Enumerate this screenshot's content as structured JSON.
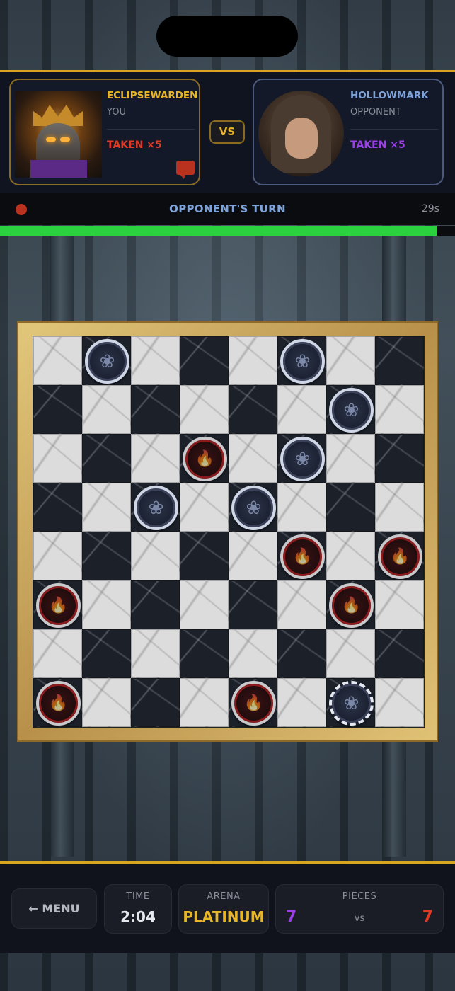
{
  "players": {
    "you": {
      "name": "ECLIPSEWARDEN",
      "role": "YOU",
      "taken": "TAKEN ×5",
      "name_color": "#e9b528",
      "taken_color": "#e03a25"
    },
    "opponent": {
      "name": "HOLLOWMARK",
      "role": "OPPONENT",
      "taken": "TAKEN ×5",
      "name_color": "#7fa3d9",
      "taken_color": "#9b3fe6"
    },
    "vs_label": "VS"
  },
  "turn": {
    "label": "OPPONENT'S TURN",
    "timer": "29s",
    "progress": 0.96
  },
  "board": {
    "size": 8,
    "pieces": [
      {
        "row": 0,
        "col": 1,
        "type": "shadow"
      },
      {
        "row": 0,
        "col": 5,
        "type": "shadow"
      },
      {
        "row": 1,
        "col": 6,
        "type": "shadow"
      },
      {
        "row": 2,
        "col": 3,
        "type": "flame"
      },
      {
        "row": 2,
        "col": 5,
        "type": "shadow"
      },
      {
        "row": 3,
        "col": 2,
        "type": "shadow"
      },
      {
        "row": 3,
        "col": 4,
        "type": "shadow"
      },
      {
        "row": 4,
        "col": 5,
        "type": "flame"
      },
      {
        "row": 4,
        "col": 7,
        "type": "flame"
      },
      {
        "row": 5,
        "col": 0,
        "type": "flame"
      },
      {
        "row": 5,
        "col": 6,
        "type": "flame"
      },
      {
        "row": 7,
        "col": 0,
        "type": "flame"
      },
      {
        "row": 7,
        "col": 4,
        "type": "flame"
      },
      {
        "row": 7,
        "col": 6,
        "type": "shadow",
        "selected": true
      }
    ],
    "dark_pattern": [
      [
        0,
        1,
        0,
        1,
        0,
        1,
        0,
        1
      ],
      [
        1,
        0,
        1,
        0,
        1,
        0,
        1,
        0
      ],
      [
        0,
        1,
        0,
        1,
        0,
        1,
        0,
        1
      ],
      [
        1,
        0,
        1,
        0,
        1,
        0,
        1,
        0
      ],
      [
        0,
        1,
        0,
        1,
        0,
        1,
        0,
        1
      ],
      [
        1,
        0,
        1,
        0,
        1,
        0,
        1,
        0
      ],
      [
        0,
        1,
        0,
        1,
        0,
        1,
        0,
        1
      ],
      [
        1,
        0,
        1,
        0,
        1,
        0,
        1,
        0
      ]
    ]
  },
  "footer": {
    "menu_label": "← MENU",
    "time_label": "TIME",
    "time_value": "2:04",
    "arena_label": "ARENA",
    "arena_value": "PLATINUM",
    "arena_color": "#e9b528",
    "pieces_label": "PIECES",
    "pieces_you": "7",
    "pieces_vs": "vs",
    "pieces_opp": "7"
  }
}
